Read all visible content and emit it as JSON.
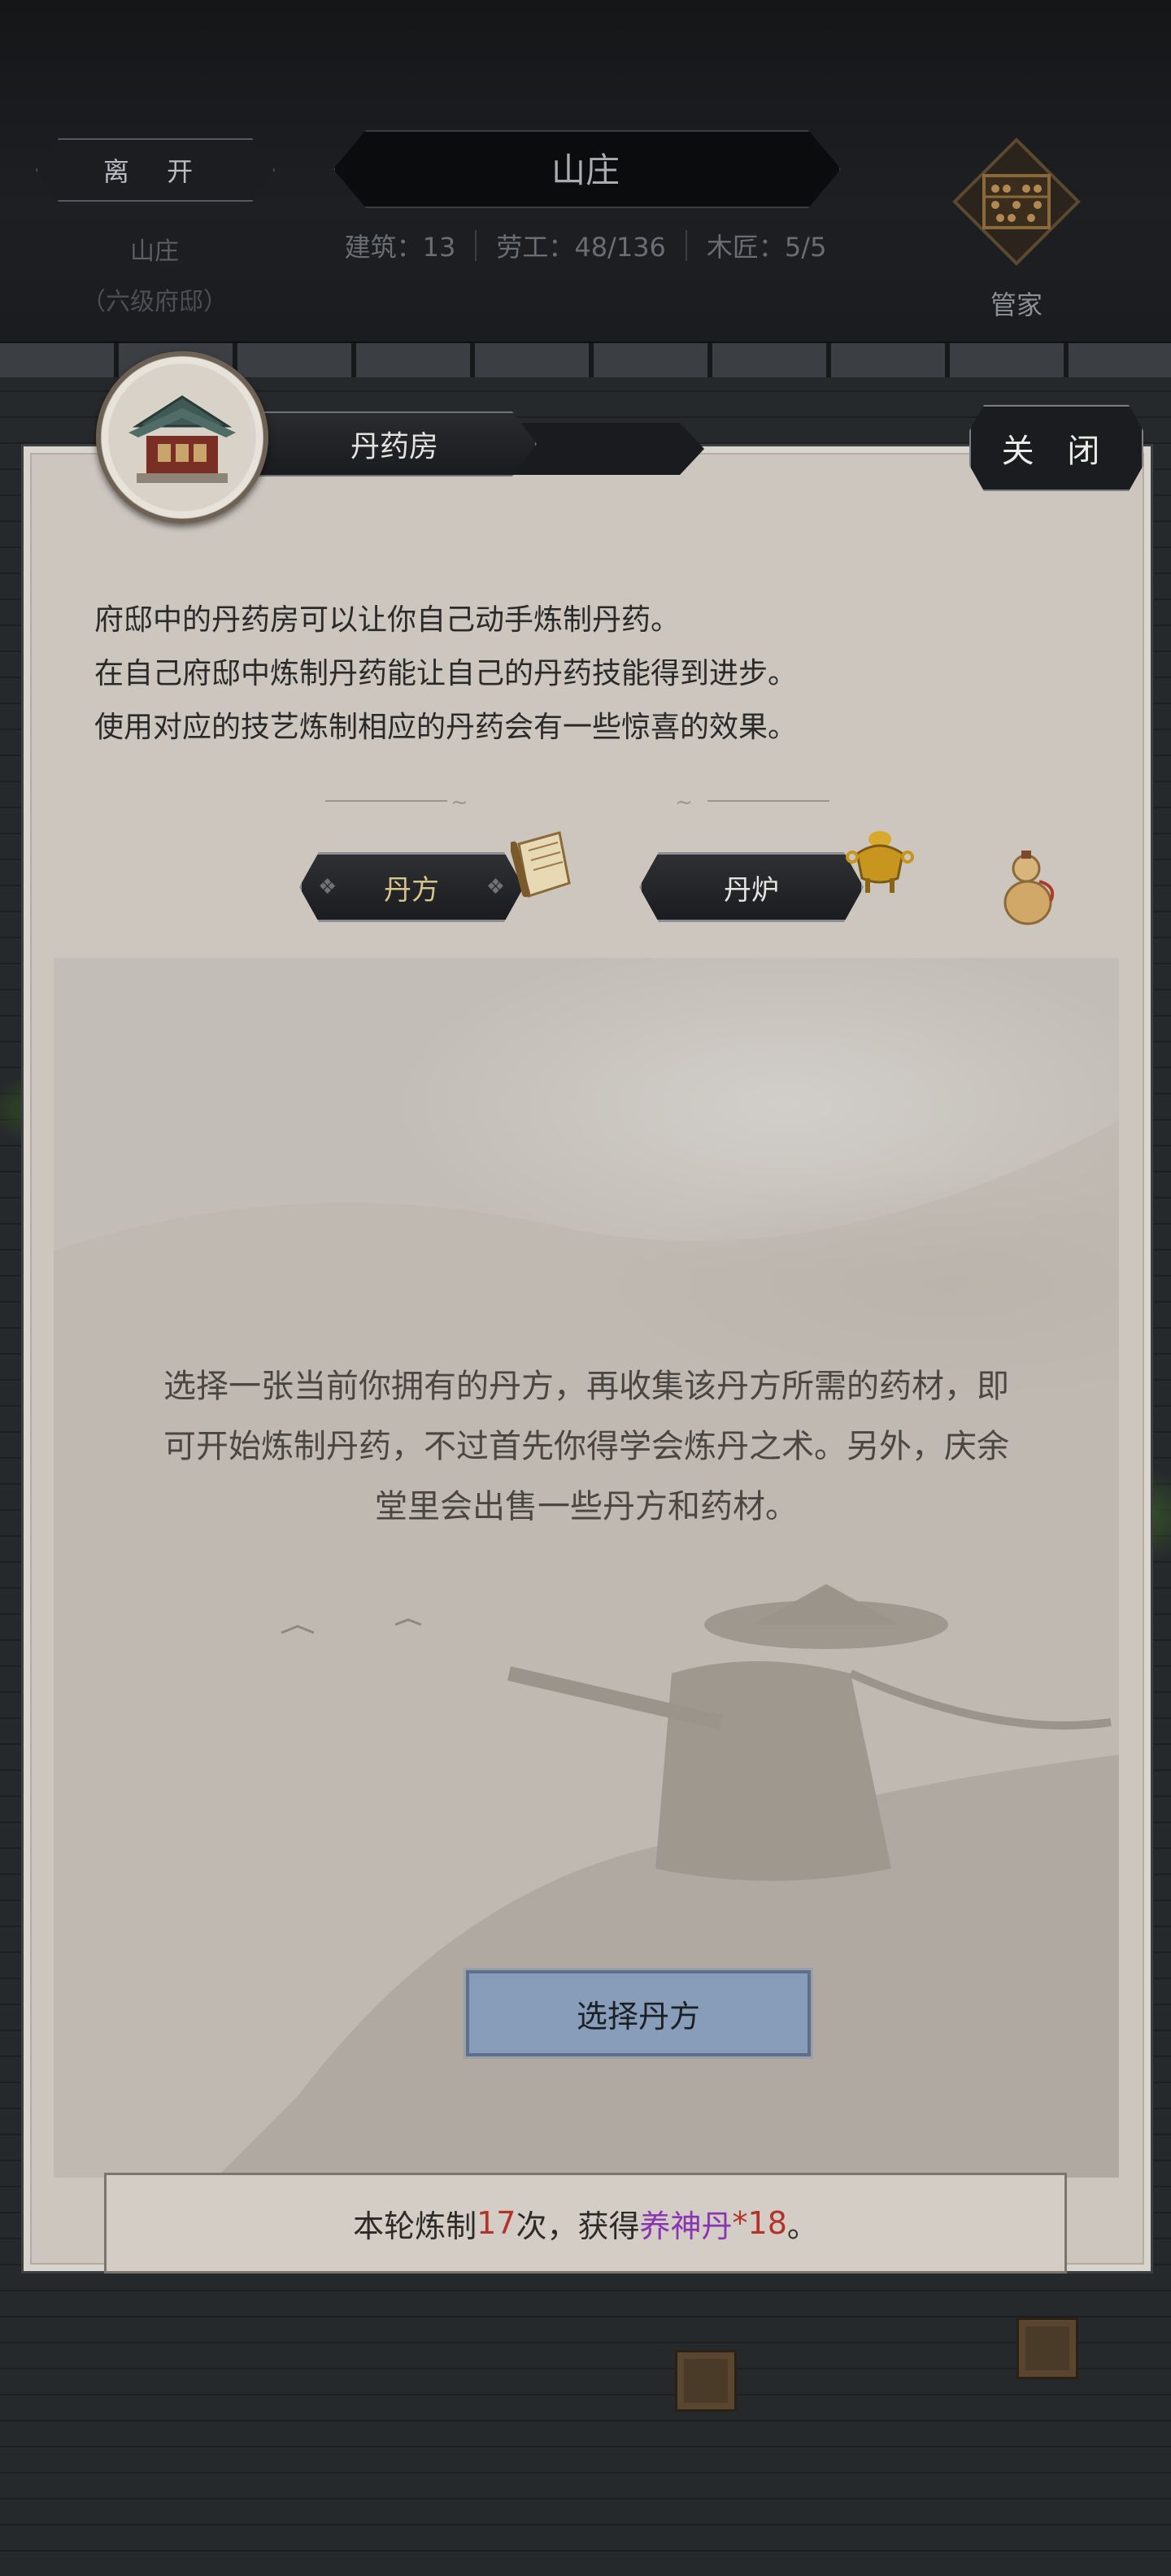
{
  "header": {
    "leave_label": "离 开",
    "location_name": "山庄",
    "location_rank": "（六级府邸）",
    "title": "山庄",
    "stats": [
      {
        "label": "建筑：",
        "value": "13"
      },
      {
        "label": "劳工：",
        "value": "48/136"
      },
      {
        "label": "木匠：",
        "value": "5/5"
      }
    ],
    "steward_label": "管家"
  },
  "panel": {
    "building_name": "丹药房",
    "close_label": "关 闭",
    "description": [
      "府邸中的丹药房可以让你自己动手炼制丹药。",
      "在自己府邸中炼制丹药能让自己的丹药技能得到进步。",
      "使用对应的技艺炼制相应的丹药会有一些惊喜的效果。"
    ],
    "tabs": {
      "recipe": "丹方",
      "furnace": "丹炉"
    },
    "intro_text": "选择一张当前你拥有的丹方，再收集该丹方所需的药材，即可开始炼制丹药，不过首先你得学会炼丹之术。另外，庆余堂里会出售一些丹方和药材。",
    "select_button": "选择丹方",
    "result": {
      "prefix": "本轮炼制",
      "count": "17",
      "middle": "次，获得",
      "item": "养神丹",
      "qty": "*18",
      "suffix": "。"
    }
  },
  "icons": [
    "abacus-icon",
    "pavilion-icon",
    "scroll-icon",
    "incense-burner-icon",
    "gourd-icon"
  ],
  "colors": {
    "panel_bg": "#ccc6bf",
    "select_button_bg": "#879dba",
    "highlight_number": "#b3332b",
    "highlight_item": "#8a33b3",
    "recipe_tab_text": "#d7c58a"
  }
}
